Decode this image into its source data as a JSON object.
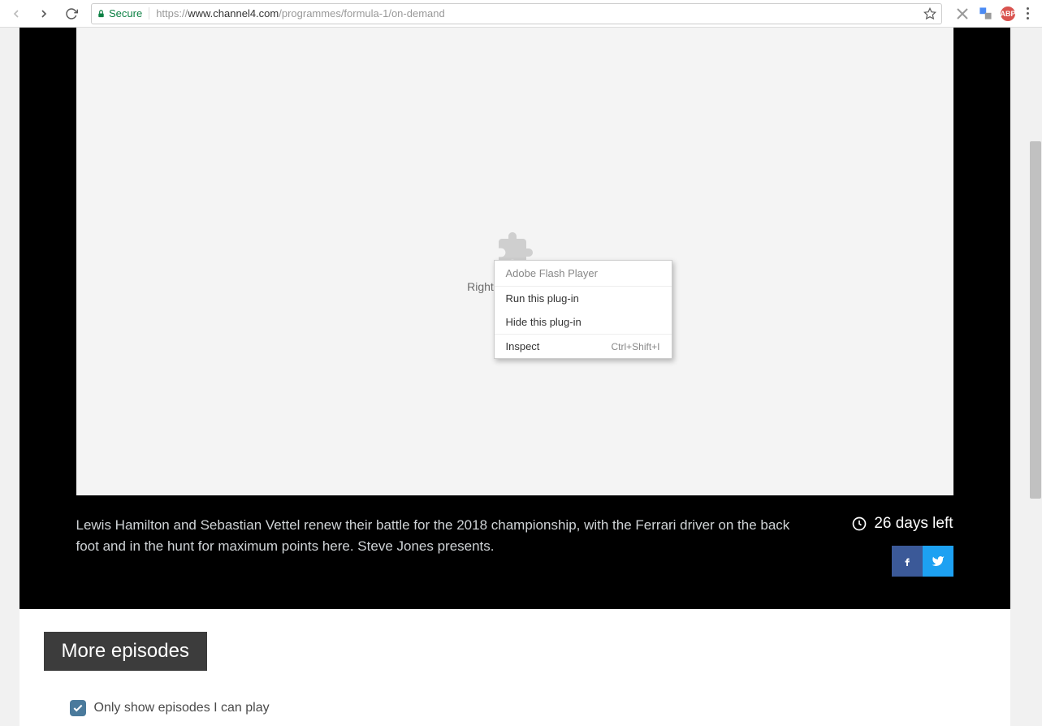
{
  "browser": {
    "secure_label": "Secure",
    "url_proto": "https://",
    "url_host": "www.channel4.com",
    "url_path": "/programmes/formula-1/on-demand",
    "abp_label": "ABP"
  },
  "player": {
    "placeholder_text": "Right-click to run A"
  },
  "context_menu": {
    "header": "Adobe Flash Player",
    "items": [
      {
        "label": "Run this plug-in",
        "shortcut": ""
      },
      {
        "label": "Hide this plug-in",
        "shortcut": ""
      }
    ],
    "inspect": {
      "label": "Inspect",
      "shortcut": "Ctrl+Shift+I"
    }
  },
  "meta": {
    "description": "Lewis Hamilton and Sebastian Vettel renew their battle for the 2018 championship, with the Ferrari driver on the back foot and in the hunt for maximum points here. Steve Jones presents.",
    "days_left": "26 days left"
  },
  "episodes": {
    "heading": "More episodes",
    "filter_label": "Only show episodes I can play"
  }
}
